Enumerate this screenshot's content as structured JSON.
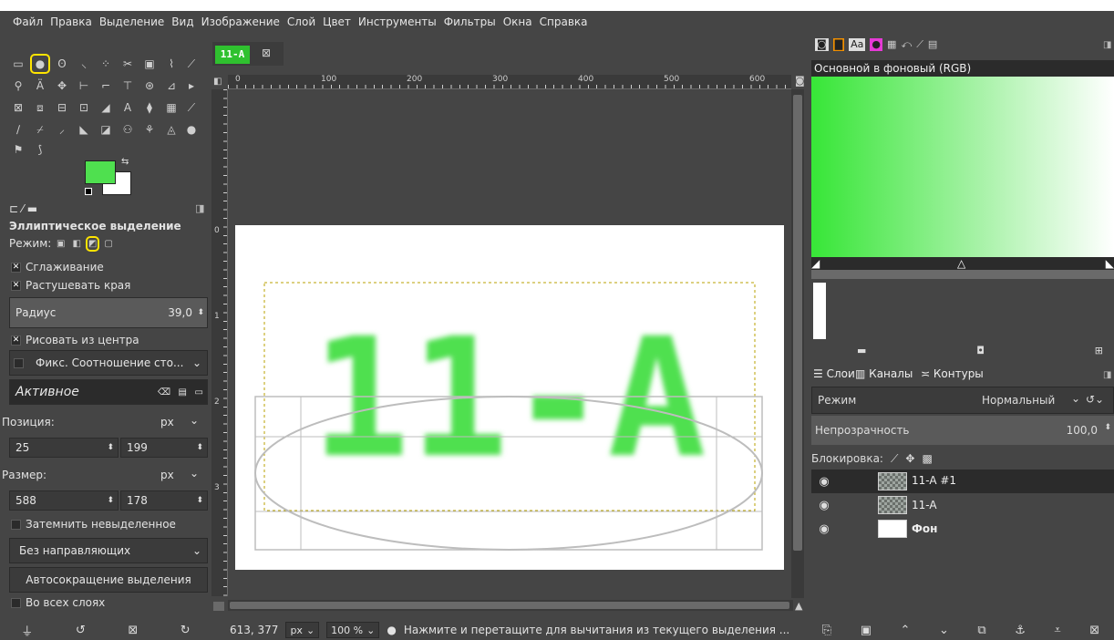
{
  "menu": [
    "Файл",
    "Правка",
    "Выделение",
    "Вид",
    "Изображение",
    "Слой",
    "Цвет",
    "Инструменты",
    "Фильтры",
    "Окна",
    "Справка"
  ],
  "image_tab": {
    "thumb_text": "11-A",
    "close_icon": "⊠"
  },
  "ruler_labels": [
    "0",
    "100",
    "200",
    "300",
    "400",
    "500",
    "600"
  ],
  "vruler_labels": [
    "0",
    "1",
    "2",
    "3"
  ],
  "tool_options": {
    "title": "Эллиптическое выделение",
    "mode_label": "Режим:",
    "antialias": "Сглаживание",
    "feather": "Растушевать края",
    "radius_label": "Радиус",
    "radius_value": "39,0",
    "expand_from_center": "Рисовать из центра",
    "fixed": "Фикс. Соотношение сто...",
    "active_value": "Активное",
    "position_label": "Позиция:",
    "unit": "px",
    "pos_x": "25",
    "pos_y": "199",
    "size_label": "Размер:",
    "size_w": "588",
    "size_h": "178",
    "highlight_unselected": "Затемнить невыделенное",
    "guides": "Без направляющих",
    "autoshrink": "Автосокращение выделения",
    "all_layers": "Во всех слоях"
  },
  "canvas": {
    "text": "11-A",
    "text_color": "#4fe04f"
  },
  "status": {
    "coords": "613, 377",
    "unit": "px",
    "zoom": "100 %",
    "message": "Нажмите и перетащите для вычитания из текущего выделения ..."
  },
  "gradient": {
    "name": "Основной в фоновый (RGB)"
  },
  "layers_panel": {
    "tab_layers": "Слои",
    "tab_channels": "Каналы",
    "tab_paths": "Контуры",
    "mode_label": "Режим",
    "mode_value": "Нормальный",
    "opacity_label": "Непрозрачность",
    "opacity_value": "100,0",
    "lock_label": "Блокировка:",
    "layers": [
      {
        "name": "11-A #1",
        "thumb": "checker"
      },
      {
        "name": "11-A",
        "thumb": "checker"
      },
      {
        "name": "Фон",
        "thumb": "white"
      }
    ]
  },
  "colors": {
    "fg": "#4fe04f",
    "bg": "#ffffff",
    "highlight": "#ffe400"
  }
}
